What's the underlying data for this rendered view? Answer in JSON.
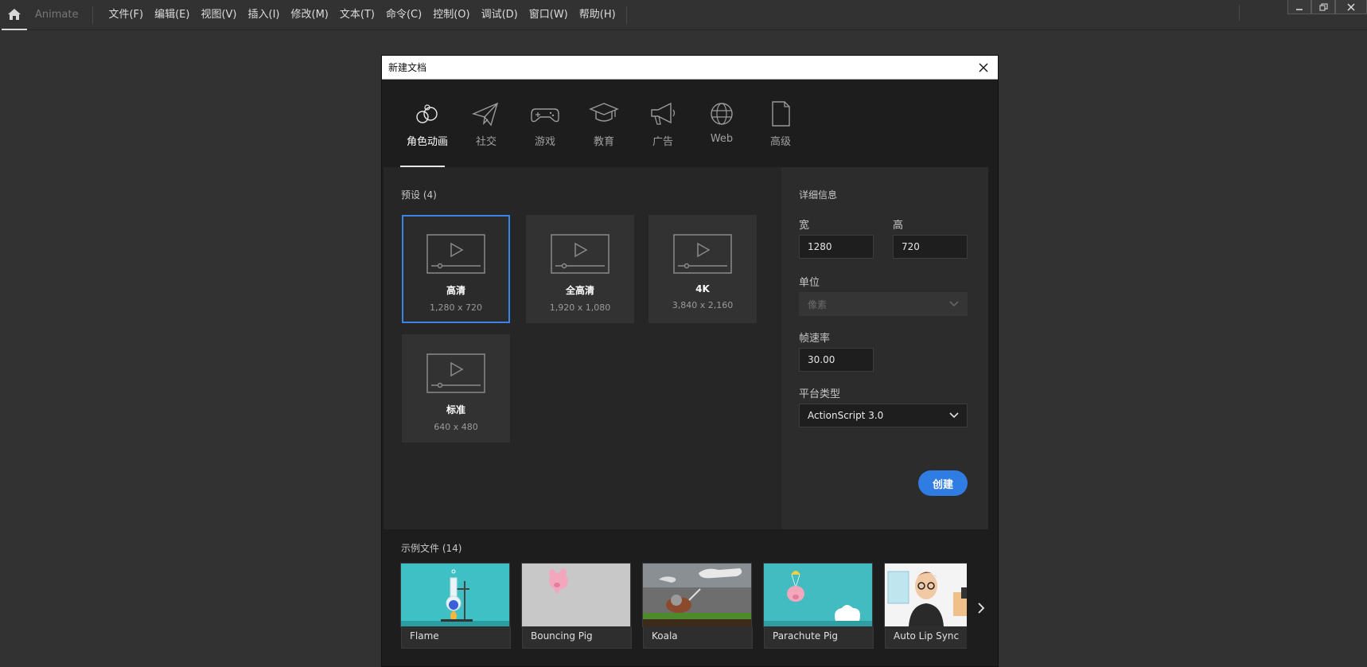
{
  "app": {
    "name": "Animate",
    "menu": [
      "文件(F)",
      "编辑(E)",
      "视图(V)",
      "插入(I)",
      "修改(M)",
      "文本(T)",
      "命令(C)",
      "控制(O)",
      "调试(D)",
      "窗口(W)",
      "帮助(H)"
    ]
  },
  "dialog": {
    "title": "新建文档",
    "categories": [
      {
        "label": "角色动画",
        "icon": "character-animation-icon",
        "active": true
      },
      {
        "label": "社交",
        "icon": "paper-plane-icon"
      },
      {
        "label": "游戏",
        "icon": "gamepad-icon"
      },
      {
        "label": "教育",
        "icon": "graduation-cap-icon"
      },
      {
        "label": "广告",
        "icon": "megaphone-icon"
      },
      {
        "label": "Web",
        "icon": "globe-icon"
      },
      {
        "label": "高级",
        "icon": "document-icon"
      }
    ],
    "presets_label": "预设 (4)",
    "presets": [
      {
        "name": "高清",
        "size": "1,280 x 720",
        "selected": true
      },
      {
        "name": "全高清",
        "size": "1,920 x 1,080"
      },
      {
        "name": "4K",
        "size": "3,840 x 2,160"
      },
      {
        "name": "标准",
        "size": "640 x 480"
      }
    ],
    "details": {
      "heading": "详细信息",
      "width_label": "宽",
      "width_value": "1280",
      "height_label": "高",
      "height_value": "720",
      "unit_label": "单位",
      "unit_value": "像素",
      "fps_label": "帧速率",
      "fps_value": "30.00",
      "platform_label": "平台类型",
      "platform_value": "ActionScript 3.0",
      "create_label": "创建"
    },
    "samples_label": "示例文件 (14)",
    "samples": [
      {
        "name": "Flame"
      },
      {
        "name": "Bouncing Pig"
      },
      {
        "name": "Koala"
      },
      {
        "name": "Parachute Pig"
      },
      {
        "name": "Auto Lip Sync"
      }
    ]
  },
  "colors": {
    "accent": "#2f7ce2",
    "selected_border": "#3a84e4",
    "background": "#323232"
  }
}
